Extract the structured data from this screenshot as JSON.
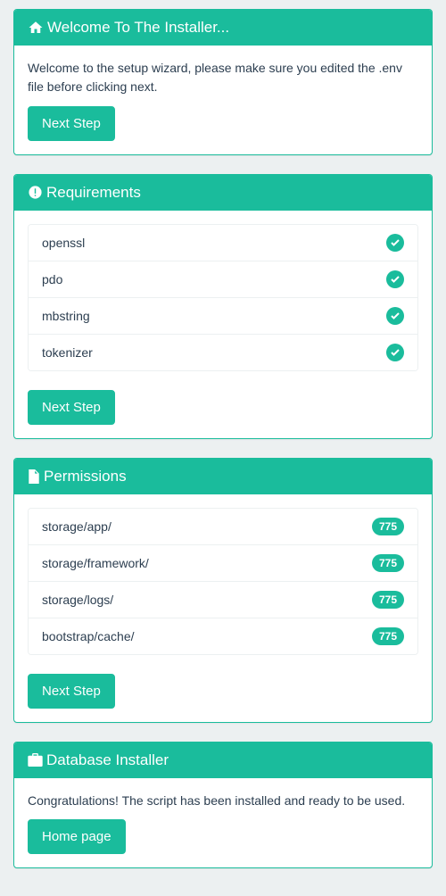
{
  "accent": "#1abc9c",
  "welcome": {
    "title": "Welcome To The Installer...",
    "text": "Welcome to the setup wizard, please make sure you edited the .env file before clicking next.",
    "button": "Next Step"
  },
  "requirements": {
    "title": "Requirements",
    "button": "Next Step",
    "items": [
      {
        "name": "openssl",
        "ok": true
      },
      {
        "name": "pdo",
        "ok": true
      },
      {
        "name": "mbstring",
        "ok": true
      },
      {
        "name": "tokenizer",
        "ok": true
      }
    ]
  },
  "permissions": {
    "title": "Permissions",
    "button": "Next Step",
    "items": [
      {
        "path": "storage/app/",
        "mode": "775"
      },
      {
        "path": "storage/framework/",
        "mode": "775"
      },
      {
        "path": "storage/logs/",
        "mode": "775"
      },
      {
        "path": "bootstrap/cache/",
        "mode": "775"
      }
    ]
  },
  "database": {
    "title": "Database Installer",
    "text": "Congratulations! The script has been installed and ready to be used.",
    "button": "Home page"
  }
}
